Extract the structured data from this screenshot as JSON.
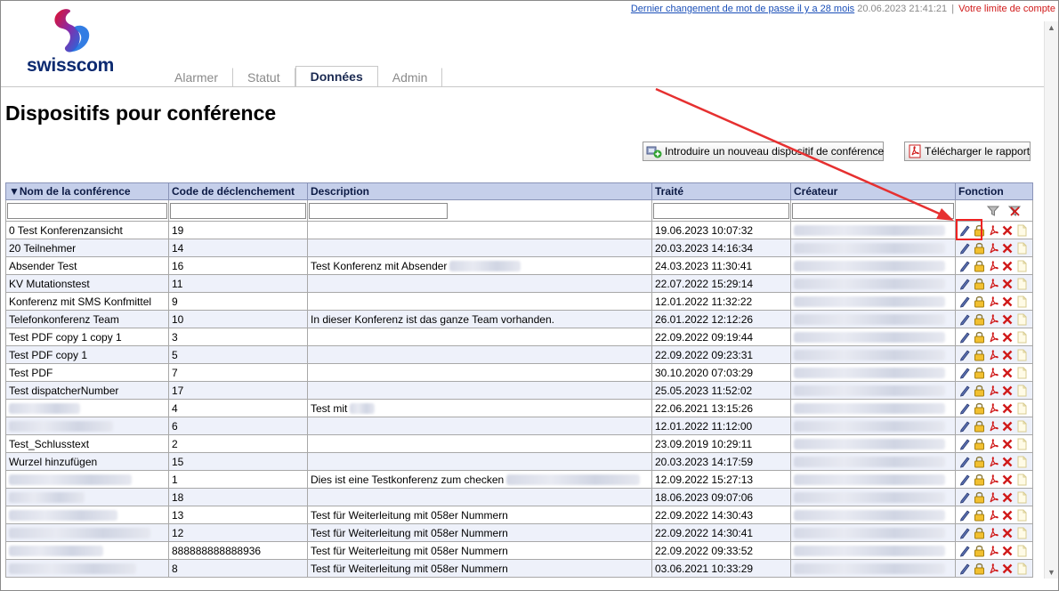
{
  "topbar": {
    "password_link": "Dernier changement de mot de passe il y a 28 mois",
    "timestamp": "20.06.2023 21:41:21",
    "separator": "|",
    "limit_text": "Votre limite de compte"
  },
  "brand": {
    "name": "swisscom"
  },
  "tabs": [
    {
      "label": "Alarmer",
      "active": false
    },
    {
      "label": "Statut",
      "active": false
    },
    {
      "label": "Données",
      "active": true
    },
    {
      "label": "Admin",
      "active": false
    }
  ],
  "page": {
    "title": "Dispositifs pour conférence",
    "new_button": "Introduire un nouveau dispositif de conférence",
    "report_button": "Télécharger le rapport"
  },
  "table": {
    "columns": [
      {
        "label": "Nom de la conférence",
        "sorted": "desc-arrow"
      },
      {
        "label": "Code de déclenchement"
      },
      {
        "label": "Description"
      },
      {
        "label": "Traité"
      },
      {
        "label": "Créateur"
      },
      {
        "label": "Fonction"
      }
    ],
    "rows": [
      {
        "name": "0 Test Konferenzansicht",
        "code": "19",
        "description": "",
        "treated": "19.06.2023 10:07:32"
      },
      {
        "name": "20 Teilnehmer",
        "code": "14",
        "description": "",
        "treated": "20.03.2023 14:16:34"
      },
      {
        "name": "Absender Test",
        "code": "16",
        "description": "Test Konferenz mit Absender",
        "treated": "24.03.2023 11:30:41",
        "desc_redacted": true
      },
      {
        "name": "KV Mutationstest",
        "code": "11",
        "description": "",
        "treated": "22.07.2022 15:29:14"
      },
      {
        "name": "Konferenz mit SMS Konfmittel",
        "code": "9",
        "description": "",
        "treated": "12.01.2022 11:32:22"
      },
      {
        "name": "Telefonkonferenz Team",
        "code": "10",
        "description": "In dieser Konferenz ist das ganze Team vorhanden.",
        "treated": "26.01.2022 12:12:26"
      },
      {
        "name": "Test PDF copy 1 copy 1",
        "code": "3",
        "description": "",
        "treated": "22.09.2022 09:19:44"
      },
      {
        "name": "Test PDF copy 1",
        "code": "5",
        "description": "",
        "treated": "22.09.2022 09:23:31"
      },
      {
        "name": "Test PDF",
        "code": "7",
        "description": "",
        "treated": "30.10.2020 07:03:29"
      },
      {
        "name": "Test dispatcherNumber",
        "code": "17",
        "description": "",
        "treated": "25.05.2023 11:52:02"
      },
      {
        "name": "",
        "code": "4",
        "description": "Test mit",
        "treated": "22.06.2021 13:15:26",
        "name_redacted": true,
        "desc_redacted": true
      },
      {
        "name": "",
        "code": "6",
        "description": "",
        "treated": "12.01.2022 11:12:00",
        "name_redacted": true
      },
      {
        "name": "Test_Schlusstext",
        "code": "2",
        "description": "",
        "treated": "23.09.2019 10:29:11"
      },
      {
        "name": "Wurzel hinzufügen",
        "code": "15",
        "description": "",
        "treated": "20.03.2023 14:17:59"
      },
      {
        "name": "",
        "code": "1",
        "description": "Dies ist eine Testkonferenz zum checken",
        "treated": "12.09.2022 15:27:13",
        "name_redacted": true,
        "desc_redacted": true
      },
      {
        "name": "",
        "code": "18",
        "description": "",
        "treated": "18.06.2023 09:07:06",
        "name_redacted": true
      },
      {
        "name": "",
        "code": "13",
        "description": "Test für Weiterleitung mit 058er Nummern",
        "treated": "22.09.2022 14:30:43",
        "name_redacted": true
      },
      {
        "name": "",
        "code": "12",
        "description": "Test für Weiterleitung mit 058er Nummern",
        "treated": "22.09.2022 14:30:41",
        "name_redacted": true
      },
      {
        "name": "",
        "code": "888888888888936",
        "description": "Test für Weiterleitung mit 058er Nummern",
        "treated": "22.09.2022 09:33:52",
        "name_redacted": true
      },
      {
        "name": "",
        "code": "8",
        "description": "Test für Weiterleitung mit 058er Nummern",
        "treated": "03.06.2021 10:33:29",
        "name_redacted": true
      }
    ],
    "row_actions": [
      "edit-icon",
      "lock-icon",
      "pdf-icon",
      "delete-icon",
      "copy-icon"
    ],
    "filter_actions": [
      "filter-icon",
      "clear-filter-icon"
    ]
  },
  "colors": {
    "header_bg": "#c5cfea",
    "row_alt_bg": "#eef1fa",
    "link": "#1a4fb8",
    "alert": "#d01a1a",
    "annotation": "#e22222"
  }
}
